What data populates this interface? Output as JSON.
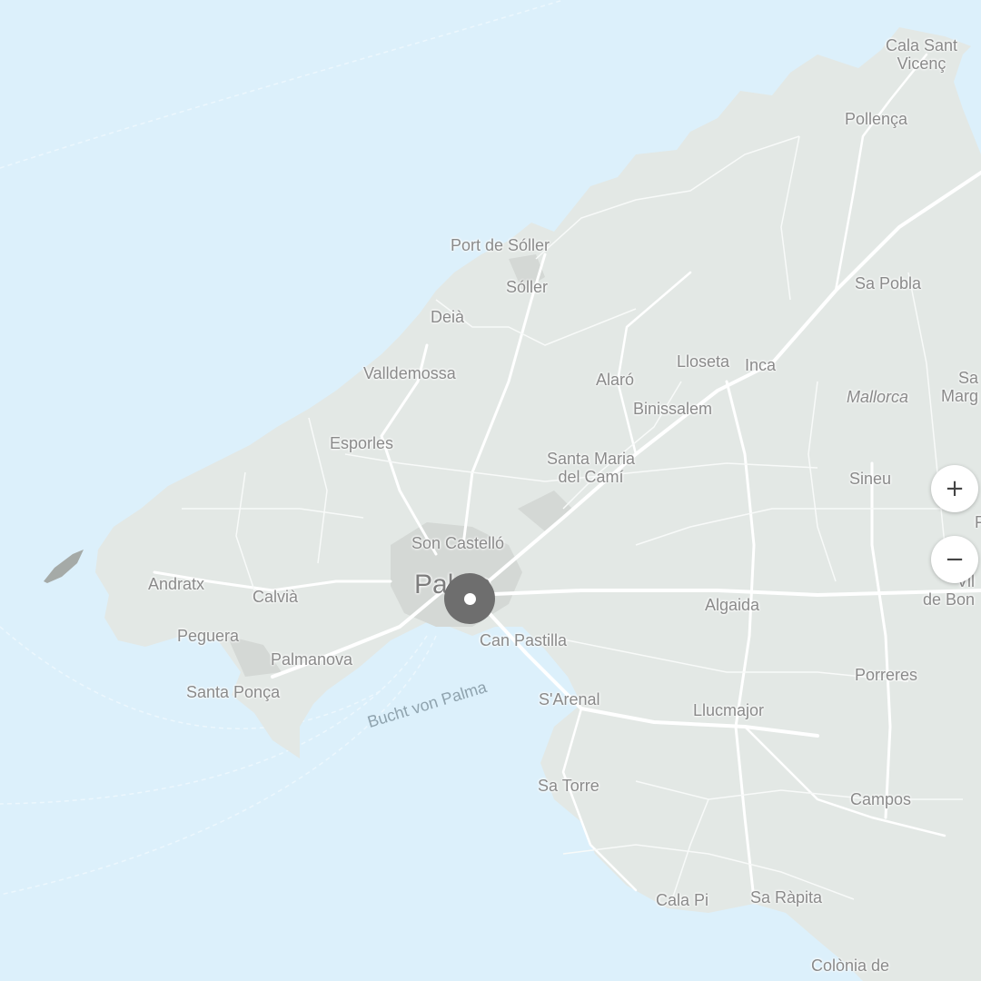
{
  "map": {
    "region_label": "Mallorca",
    "water_label": "Bucht von Palma",
    "places": {
      "cala_sant_vicenc": "Cala Sant\nVicenç",
      "pollenca": "Pollença",
      "port_de_soller": "Port de Sóller",
      "soller": "Sóller",
      "deia": "Deià",
      "sa_pobla": "Sa Pobla",
      "valldemossa": "Valldemossa",
      "alaro": "Alaró",
      "lloseta": "Lloseta",
      "inca": "Inca",
      "binissalem": "Binissalem",
      "sa_marg": "Sa\nMarg",
      "esporles": "Esporles",
      "santa_maria": "Santa Maria\ndel Camí",
      "sineu": "Sineu",
      "son_castello": "Son Castelló",
      "andratx": "Andratx",
      "calvia": "Calvià",
      "palma": "Palma",
      "vilafranca": "Vil\nde Bon",
      "algaida": "Algaida",
      "can_pastilla": "Can Pastilla",
      "peguera": "Peguera",
      "palmanova": "Palmanova",
      "porreres": "Porreres",
      "santa_ponca": "Santa Ponça",
      "s_arenal": "S'Arenal",
      "llucmajor": "Llucmajor",
      "sa_torre": "Sa Torre",
      "campos": "Campos",
      "cala_pi": "Cala Pi",
      "sa_rapita": "Sa Ràpita",
      "colonia": "Colònia de"
    },
    "edge_fragment": "F",
    "marker_icon": "location-target-icon"
  },
  "controls": {
    "zoom_in": "+",
    "zoom_out": "−"
  },
  "colors": {
    "water": "#dcf0fb",
    "land": "#e3e8e5",
    "road": "#ffffff",
    "label": "#8a8a8a",
    "marker": "#6e6e6e"
  }
}
